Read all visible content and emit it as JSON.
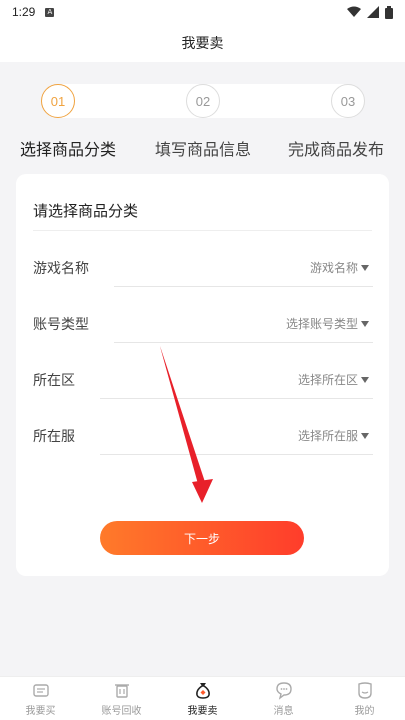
{
  "status_bar": {
    "time": "1:29",
    "badge": "A"
  },
  "header": {
    "title": "我要卖"
  },
  "steps": [
    {
      "number": "01",
      "label": "选择商品分类",
      "active": true
    },
    {
      "number": "02",
      "label": "填写商品信息",
      "active": false
    },
    {
      "number": "03",
      "label": "完成商品发布",
      "active": false
    }
  ],
  "form": {
    "title": "请选择商品分类",
    "fields": [
      {
        "label": "游戏名称",
        "placeholder": "游戏名称"
      },
      {
        "label": "账号类型",
        "placeholder": "选择账号类型"
      },
      {
        "label": "所在区",
        "placeholder": "选择所在区"
      },
      {
        "label": "所在服",
        "placeholder": "选择所在服"
      }
    ],
    "next_label": "下一步"
  },
  "tabbar": [
    {
      "label": "我要买",
      "icon": "ticket-icon",
      "active": false
    },
    {
      "label": "账号回收",
      "icon": "trash-icon",
      "active": false
    },
    {
      "label": "我要卖",
      "icon": "money-bag-icon",
      "active": true
    },
    {
      "label": "消息",
      "icon": "chat-bubble-icon",
      "active": false
    },
    {
      "label": "我的",
      "icon": "profile-icon",
      "active": false
    }
  ],
  "colors": {
    "accent": "#f0a340",
    "button_start": "#ff7a2a",
    "button_end": "#ff3d2b",
    "annotation_arrow": "#e8202a"
  }
}
